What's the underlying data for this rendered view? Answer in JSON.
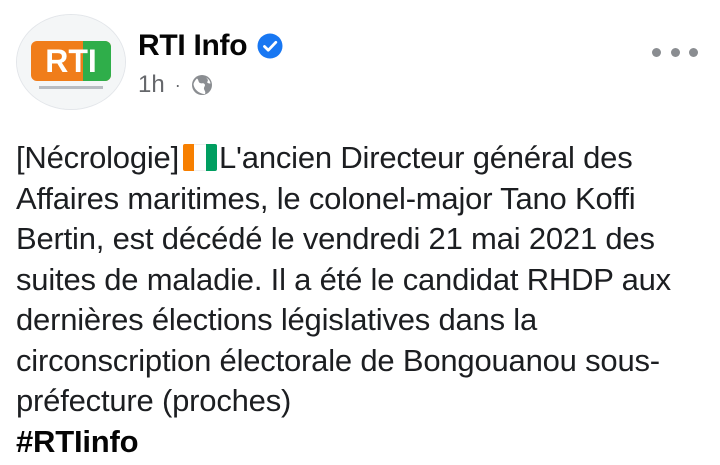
{
  "post": {
    "page_name": "RTI Info",
    "time": "1h",
    "separator": "·",
    "privacy_icon": "globe-icon",
    "verified_icon": "verified-badge-icon",
    "more_icon": "more-options-icon",
    "avatar": {
      "logo_text": "RTI",
      "colors": {
        "orange": "#f07d1a",
        "green": "#2fae4a",
        "border": "#e3e6ea"
      }
    },
    "text": {
      "prefix": "[Nécrologie]",
      "flag_icon": "ivory-coast-flag-icon",
      "flag_colors": [
        "#f77f00",
        "#ffffff",
        "#009e60"
      ],
      "body": "L'ancien Directeur général des Affaires maritimes, le colonel-major Tano Koffi Bertin, est décédé le vendredi 21 mai 2021 des suites de maladie. Il a été le candidat RHDP aux dernières élections législatives dans la circonscription électorale de Bongouanou sous-préfecture (proches)",
      "hashtag": "#RTIinfo"
    },
    "colors": {
      "verified_blue": "#1877f2",
      "meta_gray": "#65676b",
      "text": "#1c1e21"
    }
  }
}
